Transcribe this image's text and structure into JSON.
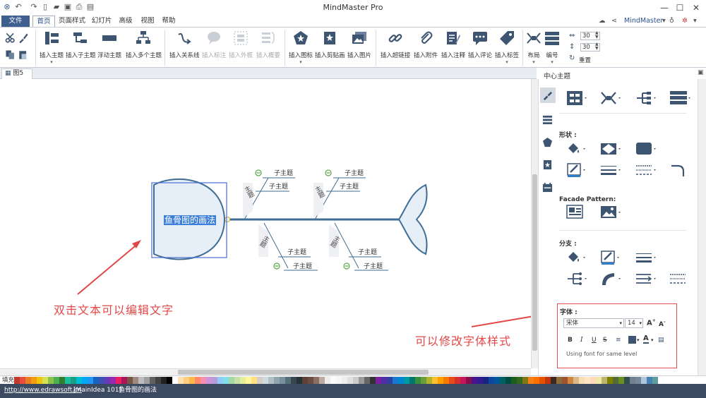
{
  "app": {
    "title": "MindMaster Pro"
  },
  "menu": {
    "file": "文件",
    "tabs": [
      "首页",
      "页面样式",
      "幻灯片",
      "高级",
      "视图",
      "帮助"
    ],
    "active": "首页",
    "account": "MindMaster"
  },
  "ribbon": {
    "insert_topic": "插入主题",
    "insert_subtopic": "插入子主题",
    "floating_topic": "浮动主题",
    "insert_multiple": "插入多个主题",
    "insert_relation": "插入关系线",
    "insert_callout": "插入标注",
    "insert_boundary": "插入外框",
    "insert_summary": "插入概要",
    "insert_icon": "插入图标",
    "insert_clipart": "插入剪贴画",
    "insert_image": "插入图片",
    "insert_hyperlink": "插入超链接",
    "insert_attachment": "插入附件",
    "insert_note": "插入注释",
    "insert_comment": "插入评论",
    "insert_tag": "插入标签",
    "layout": "布局",
    "numbering": "编号",
    "spacing_h": "30",
    "spacing_v": "30",
    "reset": "重置"
  },
  "doc_tab": {
    "label": "图5"
  },
  "canvas": {
    "central_topic": "鱼骨图的画法",
    "topics": [
      {
        "label": "主题",
        "subtopics": [
          "子主题",
          "子主题"
        ]
      },
      {
        "label": "主题",
        "subtopics": [
          "子主题",
          "子主题"
        ]
      },
      {
        "label": "主题",
        "subtopics": [
          "子主题",
          "子主题"
        ]
      },
      {
        "label": "主题",
        "subtopics": [
          "子主题",
          "子主题"
        ]
      }
    ]
  },
  "annotations": {
    "left": "双击文本可以编辑文字",
    "right": "可以修改字体样式"
  },
  "panel": {
    "title": "中心主题",
    "shape_label": "形状 :",
    "facade_label": "Facade Pattern:",
    "branch_label": "分支 :",
    "font_label": "字体 :",
    "font_name": "宋体",
    "font_size": "14",
    "font_preview": "Using font for same level"
  },
  "colorbar": {
    "label": "填充"
  },
  "status": {
    "url": "http://www.edrawsoft.cn",
    "info": "[MainIdea 101]",
    "topic": "鱼骨图的画法"
  },
  "colors": {
    "accent": "#3f5f8f",
    "annotation": "#e24848",
    "fish": "#3e6e96",
    "fish_fill": "#e6eef7"
  }
}
